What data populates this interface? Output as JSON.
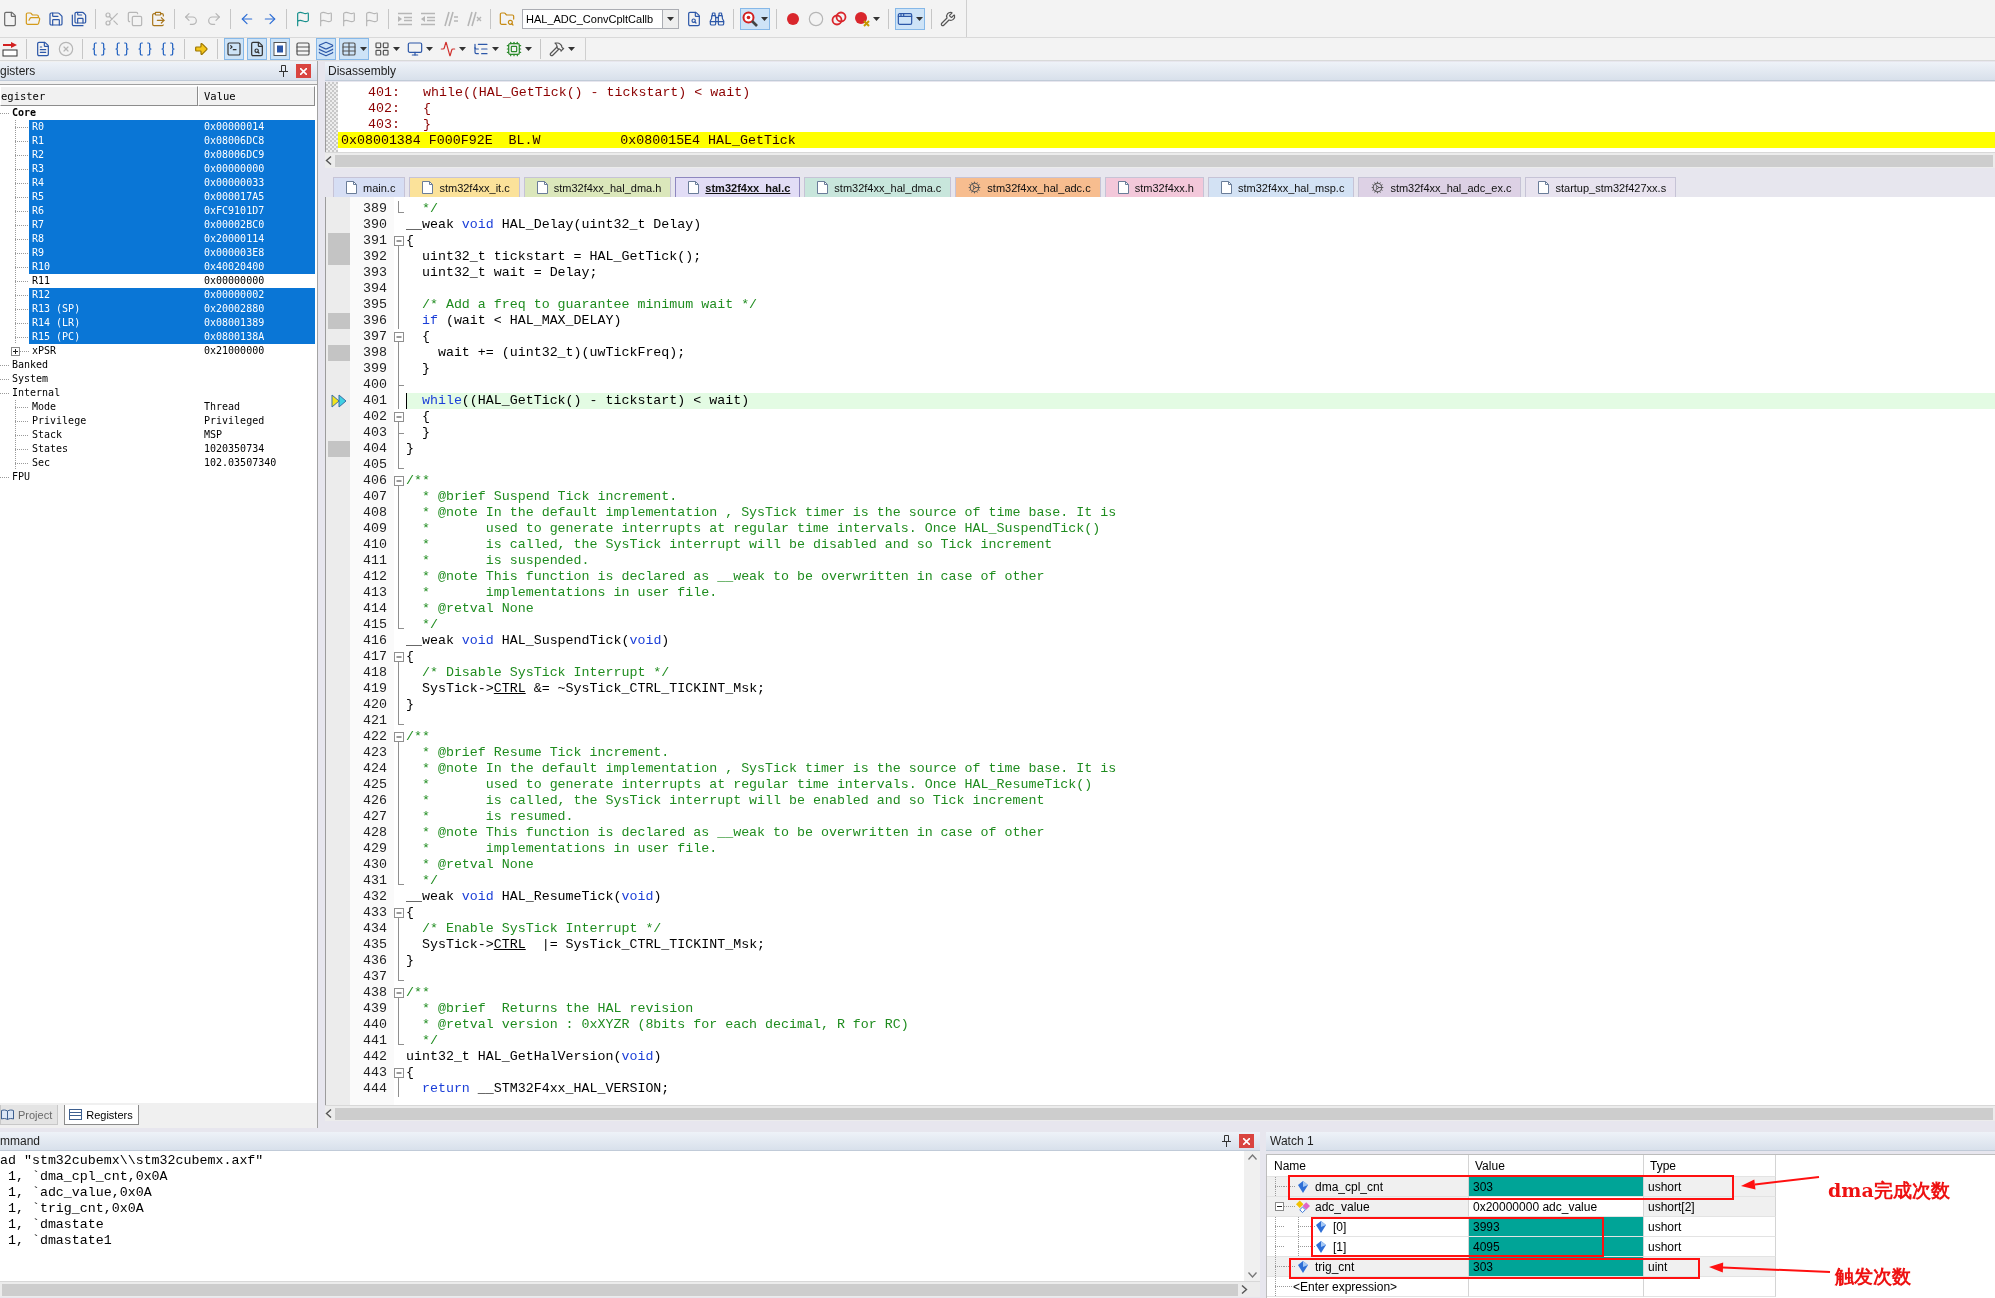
{
  "toolbars": [
    [
      {
        "kind": "new",
        "disabled": false,
        "pressed": false,
        "dropdown": false
      },
      {
        "kind": "open",
        "disabled": false,
        "pressed": false,
        "dropdown": false
      },
      {
        "kind": "save",
        "disabled": false,
        "pressed": false,
        "dropdown": false
      },
      {
        "kind": "saveall",
        "disabled": false,
        "pressed": false,
        "dropdown": false
      },
      {
        "kind": "separator"
      },
      {
        "kind": "cut",
        "disabled": true,
        "pressed": false,
        "dropdown": false
      },
      {
        "kind": "copy",
        "disabled": true,
        "pressed": false,
        "dropdown": false
      },
      {
        "kind": "paste",
        "disabled": false,
        "pressed": false,
        "dropdown": false
      },
      {
        "kind": "separator"
      },
      {
        "kind": "undo",
        "disabled": true,
        "pressed": false,
        "dropdown": false
      },
      {
        "kind": "redo",
        "disabled": true,
        "pressed": false,
        "dropdown": false
      },
      {
        "kind": "separator"
      },
      {
        "kind": "back",
        "disabled": false,
        "pressed": false,
        "dropdown": false
      },
      {
        "kind": "forward",
        "disabled": false,
        "pressed": false,
        "dropdown": false
      },
      {
        "kind": "separator"
      },
      {
        "kind": "bookmark",
        "disabled": false,
        "pressed": false,
        "dropdown": false
      },
      {
        "kind": "prevmark",
        "disabled": true,
        "pressed": false,
        "dropdown": false
      },
      {
        "kind": "nextmark",
        "disabled": true,
        "pressed": false,
        "dropdown": false
      },
      {
        "kind": "clearmarks",
        "disabled": true,
        "pressed": false,
        "dropdown": false
      },
      {
        "kind": "separator"
      },
      {
        "kind": "indent",
        "disabled": true,
        "pressed": false,
        "dropdown": false
      },
      {
        "kind": "outdent",
        "disabled": true,
        "pressed": false,
        "dropdown": false
      },
      {
        "kind": "comment",
        "disabled": true,
        "pressed": false,
        "dropdown": false
      },
      {
        "kind": "uncomment",
        "disabled": true,
        "pressed": false,
        "dropdown": false
      },
      {
        "kind": "separator"
      },
      {
        "kind": "findfiles",
        "disabled": false,
        "pressed": false,
        "dropdown": false
      },
      {
        "kind": "combo",
        "value": "HAL_ADC_ConvCpltCallb"
      },
      {
        "kind": "find",
        "disabled": false,
        "pressed": false,
        "dropdown": false
      },
      {
        "kind": "incfind",
        "disabled": false,
        "pressed": false,
        "dropdown": false
      },
      {
        "kind": "separator"
      },
      {
        "kind": "debug",
        "disabled": false,
        "pressed": true,
        "dropdown": true
      },
      {
        "kind": "separator"
      },
      {
        "kind": "breakpoint",
        "disabled": false,
        "pressed": false,
        "dropdown": false
      },
      {
        "kind": "bptoggle",
        "disabled": true,
        "pressed": false,
        "dropdown": false
      },
      {
        "kind": "bpdisableall",
        "disabled": false,
        "pressed": false,
        "dropdown": false
      },
      {
        "kind": "bpkill",
        "disabled": false,
        "pressed": false,
        "dropdown": true
      },
      {
        "kind": "separator"
      },
      {
        "kind": "layout",
        "disabled": false,
        "pressed": true,
        "dropdown": true
      },
      {
        "kind": "separator"
      },
      {
        "kind": "config",
        "disabled": false,
        "pressed": false,
        "dropdown": false
      }
    ],
    [
      {
        "kind": "reset",
        "disabled": false,
        "pressed": false,
        "dropdown": false
      },
      {
        "kind": "separator"
      },
      {
        "kind": "run",
        "disabled": false,
        "pressed": false,
        "dropdown": false
      },
      {
        "kind": "stop",
        "disabled": true,
        "pressed": false,
        "dropdown": false
      },
      {
        "kind": "separator"
      },
      {
        "kind": "stepin",
        "disabled": false,
        "pressed": false,
        "dropdown": false
      },
      {
        "kind": "stepover",
        "disabled": false,
        "pressed": false,
        "dropdown": false
      },
      {
        "kind": "stepout",
        "disabled": false,
        "pressed": false,
        "dropdown": false
      },
      {
        "kind": "runcursor",
        "disabled": false,
        "pressed": false,
        "dropdown": false
      },
      {
        "kind": "separator"
      },
      {
        "kind": "nextstmt",
        "disabled": false,
        "pressed": false,
        "dropdown": false
      },
      {
        "kind": "separator"
      },
      {
        "kind": "cmdwin",
        "disabled": false,
        "pressed": true,
        "dropdown": false
      },
      {
        "kind": "disasm",
        "disabled": false,
        "pressed": true,
        "dropdown": false
      },
      {
        "kind": "symbols",
        "disabled": false,
        "pressed": true,
        "dropdown": false
      },
      {
        "kind": "regs",
        "disabled": false,
        "pressed": false,
        "dropdown": false
      },
      {
        "kind": "callstack",
        "disabled": false,
        "pressed": true,
        "dropdown": false
      },
      {
        "kind": "watch",
        "disabled": false,
        "pressed": true,
        "dropdown": true
      },
      {
        "kind": "memory",
        "disabled": false,
        "pressed": false,
        "dropdown": true
      },
      {
        "kind": "serial",
        "disabled": false,
        "pressed": false,
        "dropdown": true
      },
      {
        "kind": "analysis",
        "disabled": false,
        "pressed": false,
        "dropdown": true
      },
      {
        "kind": "trace",
        "disabled": false,
        "pressed": false,
        "dropdown": true
      },
      {
        "kind": "sysview",
        "disabled": false,
        "pressed": false,
        "dropdown": true
      },
      {
        "kind": "separator"
      },
      {
        "kind": "toolbox",
        "disabled": false,
        "pressed": false,
        "dropdown": true
      }
    ]
  ],
  "registers": {
    "title": "gisters",
    "columns": [
      "egister",
      "Value"
    ],
    "items": [
      {
        "name": "Core",
        "changed": true,
        "children": [
          {
            "name": "R0",
            "value": "0x00000014",
            "changed": true
          },
          {
            "name": "R1",
            "value": "0x08006DC8",
            "changed": true
          },
          {
            "name": "R2",
            "value": "0x08006DC9",
            "changed": true
          },
          {
            "name": "R3",
            "value": "0x00000000",
            "changed": true
          },
          {
            "name": "R4",
            "value": "0x00000033",
            "changed": true
          },
          {
            "name": "R5",
            "value": "0x000017A5",
            "changed": true
          },
          {
            "name": "R6",
            "value": "0xFC9101D7",
            "changed": true
          },
          {
            "name": "R7",
            "value": "0x00002BC0",
            "changed": true
          },
          {
            "name": "R8",
            "value": "0x20000114",
            "changed": true
          },
          {
            "name": "R9",
            "value": "0x000003E8",
            "changed": true
          },
          {
            "name": "R10",
            "value": "0x40020400",
            "changed": true
          },
          {
            "name": "R11",
            "value": "0x00000000",
            "changed": false
          },
          {
            "name": "R12",
            "value": "0x00000002",
            "changed": true
          },
          {
            "name": "R13 (SP)",
            "value": "0x20002880",
            "changed": true
          },
          {
            "name": "R14 (LR)",
            "value": "0x08001389",
            "changed": true
          },
          {
            "name": "R15 (PC)",
            "value": "0x0800138A",
            "changed": true
          },
          {
            "name": "xPSR",
            "value": "0x21000000",
            "changed": false,
            "expanded": false
          }
        ]
      },
      {
        "name": "Banked",
        "changed": false
      },
      {
        "name": "System",
        "changed": false
      },
      {
        "name": "Internal",
        "changed": false,
        "children": [
          {
            "name": "Mode",
            "value": "Thread",
            "changed": false
          },
          {
            "name": "Privilege",
            "value": "Privileged",
            "changed": false
          },
          {
            "name": "Stack",
            "value": "MSP",
            "changed": false
          },
          {
            "name": "States",
            "value": "1020350734",
            "changed": false
          },
          {
            "name": "Sec",
            "value": "102.03507340",
            "changed": false
          }
        ]
      },
      {
        "name": "FPU",
        "changed": false
      }
    ],
    "tabs": [
      {
        "label": "Project",
        "selected": false
      },
      {
        "label": "Registers",
        "selected": true
      }
    ]
  },
  "disassembly": {
    "title": "Disassembly",
    "lines": [
      {
        "kind": "source",
        "number": "401:",
        "code": "while((HAL_GetTick() - tickstart) < wait)",
        "current": false
      },
      {
        "kind": "source",
        "number": "402:",
        "code": "{",
        "current": false
      },
      {
        "kind": "source",
        "number": "403:",
        "code": "}",
        "current": false
      },
      {
        "kind": "instruction",
        "text": "0x08001384 F000F92E  BL.W          0x080015E4 HAL_GetTick",
        "current": true
      }
    ]
  },
  "editor": {
    "tabs": [
      {
        "label": "main.c",
        "kind": "file",
        "color": "#d6def4",
        "selected": false
      },
      {
        "label": "stm32f4xx_it.c",
        "kind": "file",
        "color": "#fbe29a",
        "selected": false
      },
      {
        "label": "stm32f4xx_hal_dma.h",
        "kind": "file",
        "color": "#dbe7bb",
        "selected": false
      },
      {
        "label": "stm32f4xx_hal.c",
        "kind": "file",
        "color": "#e2ddf6",
        "selected": true
      },
      {
        "label": "stm32f4xx_hal_dma.c",
        "kind": "file",
        "color": "#c8e6dc",
        "selected": false
      },
      {
        "label": "stm32f4xx_hal_adc.c",
        "kind": "gear",
        "color": "#f7bd8f",
        "selected": false
      },
      {
        "label": "stm32f4xx.h",
        "kind": "file",
        "color": "#f3c8da",
        "selected": false
      },
      {
        "label": "stm32f4xx_hal_msp.c",
        "kind": "file",
        "color": "#d3e2f4",
        "selected": false
      },
      {
        "label": "stm32f4xx_hal_adc_ex.c",
        "kind": "gear",
        "color": "#ddd1e5",
        "selected": false
      },
      {
        "label": "startup_stm32f427xx.s",
        "kind": "file",
        "color": "#e8e3ef",
        "selected": false
      }
    ],
    "lines": [
      {
        "number": "389",
        "kind": "foldend",
        "executable": false,
        "current": false,
        "parts": [
          {
            "kind": "comment",
            "text": "  */"
          }
        ]
      },
      {
        "number": "390",
        "kind": "plain",
        "executable": false,
        "current": false,
        "parts": [
          {
            "kind": "code",
            "text": "__weak "
          },
          {
            "kind": "keyword",
            "text": "void"
          },
          {
            "kind": "code",
            "text": " HAL_Delay(uint32_t Delay)"
          }
        ]
      },
      {
        "number": "391",
        "kind": "foldstart",
        "executable": true,
        "current": false,
        "parts": [
          {
            "kind": "code",
            "text": "{"
          }
        ]
      },
      {
        "number": "392",
        "kind": "foldmid",
        "executable": true,
        "current": false,
        "parts": [
          {
            "kind": "code",
            "text": "  uint32_t tickstart = HAL_GetTick();"
          }
        ]
      },
      {
        "number": "393",
        "kind": "foldmid",
        "executable": false,
        "current": false,
        "parts": [
          {
            "kind": "code",
            "text": "  uint32_t wait = Delay;"
          }
        ]
      },
      {
        "number": "394",
        "kind": "foldmid",
        "executable": false,
        "current": false
      },
      {
        "number": "395",
        "kind": "foldmid",
        "executable": false,
        "current": false,
        "parts": [
          {
            "kind": "comment",
            "text": "  /* Add a freq to guarantee minimum wait */"
          }
        ]
      },
      {
        "number": "396",
        "kind": "foldmid",
        "executable": true,
        "current": false,
        "parts": [
          {
            "kind": "keyword",
            "text": "  if"
          },
          {
            "kind": "code",
            "text": " (wait < HAL_MAX_DELAY)"
          }
        ]
      },
      {
        "number": "397",
        "kind": "foldstart",
        "executable": false,
        "current": false,
        "parts": [
          {
            "kind": "code",
            "text": "  {"
          }
        ]
      },
      {
        "number": "398",
        "kind": "foldmid",
        "executable": true,
        "current": false,
        "parts": [
          {
            "kind": "code",
            "text": "    wait += (uint32_t)(uwTickFreq);"
          }
        ]
      },
      {
        "number": "399",
        "kind": "foldmid",
        "executable": false,
        "current": false,
        "parts": [
          {
            "kind": "code",
            "text": "  }"
          }
        ]
      },
      {
        "number": "400",
        "kind": "foldtee",
        "executable": false,
        "current": false
      },
      {
        "number": "401",
        "kind": "foldmid",
        "executable": false,
        "current": true,
        "parts": [
          {
            "kind": "keyword",
            "text": "  while"
          },
          {
            "kind": "code",
            "text": "((HAL_GetTick() - tickstart) < wait)"
          }
        ]
      },
      {
        "number": "402",
        "kind": "foldstart",
        "executable": false,
        "current": false,
        "parts": [
          {
            "kind": "code",
            "text": "  {"
          }
        ]
      },
      {
        "number": "403",
        "kind": "foldtee",
        "executable": false,
        "current": false,
        "parts": [
          {
            "kind": "code",
            "text": "  }"
          }
        ]
      },
      {
        "number": "404",
        "kind": "foldmid",
        "executable": true,
        "current": false,
        "parts": [
          {
            "kind": "code",
            "text": "}"
          }
        ]
      },
      {
        "number": "405",
        "kind": "foldend",
        "executable": false,
        "current": false
      },
      {
        "number": "406",
        "kind": "foldstart",
        "executable": false,
        "current": false,
        "parts": [
          {
            "kind": "comment",
            "text": "/**"
          }
        ]
      },
      {
        "number": "407",
        "kind": "foldmid",
        "executable": false,
        "current": false,
        "parts": [
          {
            "kind": "comment",
            "text": "  * @brief Suspend Tick increment."
          }
        ]
      },
      {
        "number": "408",
        "kind": "foldmid",
        "executable": false,
        "current": false,
        "parts": [
          {
            "kind": "comment",
            "text": "  * @note In the default implementation , SysTick timer is the source of time base. It is"
          }
        ]
      },
      {
        "number": "409",
        "kind": "foldmid",
        "executable": false,
        "current": false,
        "parts": [
          {
            "kind": "comment",
            "text": "  *       used to generate interrupts at regular time intervals. Once HAL_SuspendTick()"
          }
        ]
      },
      {
        "number": "410",
        "kind": "foldmid",
        "executable": false,
        "current": false,
        "parts": [
          {
            "kind": "comment",
            "text": "  *       is called, the SysTick interrupt will be disabled and so Tick increment"
          }
        ]
      },
      {
        "number": "411",
        "kind": "foldmid",
        "executable": false,
        "current": false,
        "parts": [
          {
            "kind": "comment",
            "text": "  *       is suspended."
          }
        ]
      },
      {
        "number": "412",
        "kind": "foldmid",
        "executable": false,
        "current": false,
        "parts": [
          {
            "kind": "comment",
            "text": "  * @note This function is declared as __weak to be overwritten in case of other"
          }
        ]
      },
      {
        "number": "413",
        "kind": "foldmid",
        "executable": false,
        "current": false,
        "parts": [
          {
            "kind": "comment",
            "text": "  *       implementations in user file."
          }
        ]
      },
      {
        "number": "414",
        "kind": "foldmid",
        "executable": false,
        "current": false,
        "parts": [
          {
            "kind": "comment",
            "text": "  * @retval None"
          }
        ]
      },
      {
        "number": "415",
        "kind": "foldend",
        "executable": false,
        "current": false,
        "parts": [
          {
            "kind": "comment",
            "text": "  */"
          }
        ]
      },
      {
        "number": "416",
        "kind": "plain",
        "executable": false,
        "current": false,
        "parts": [
          {
            "kind": "code",
            "text": "__weak "
          },
          {
            "kind": "keyword",
            "text": "void"
          },
          {
            "kind": "code",
            "text": " HAL_SuspendTick("
          },
          {
            "kind": "keyword",
            "text": "void"
          },
          {
            "kind": "code",
            "text": ")"
          }
        ]
      },
      {
        "number": "417",
        "kind": "foldstart",
        "executable": false,
        "current": false,
        "parts": [
          {
            "kind": "code",
            "text": "{"
          }
        ]
      },
      {
        "number": "418",
        "kind": "foldmid",
        "executable": false,
        "current": false,
        "parts": [
          {
            "kind": "comment",
            "text": "  /* Disable SysTick Interrupt */"
          }
        ]
      },
      {
        "number": "419",
        "kind": "foldmid",
        "executable": false,
        "current": false,
        "parts": [
          {
            "kind": "code",
            "text": "  SysTick->"
          },
          {
            "kind": "member",
            "text": "CTRL"
          },
          {
            "kind": "code",
            "text": " &= ~SysTick_CTRL_TICKINT_Msk;"
          }
        ]
      },
      {
        "number": "420",
        "kind": "foldmid",
        "executable": false,
        "current": false,
        "parts": [
          {
            "kind": "code",
            "text": "}"
          }
        ]
      },
      {
        "number": "421",
        "kind": "foldend",
        "executable": false,
        "current": false
      },
      {
        "number": "422",
        "kind": "foldstart",
        "executable": false,
        "current": false,
        "parts": [
          {
            "kind": "comment",
            "text": "/**"
          }
        ]
      },
      {
        "number": "423",
        "kind": "foldmid",
        "executable": false,
        "current": false,
        "parts": [
          {
            "kind": "comment",
            "text": "  * @brief Resume Tick increment."
          }
        ]
      },
      {
        "number": "424",
        "kind": "foldmid",
        "executable": false,
        "current": false,
        "parts": [
          {
            "kind": "comment",
            "text": "  * @note In the default implementation , SysTick timer is the source of time base. It is"
          }
        ]
      },
      {
        "number": "425",
        "kind": "foldmid",
        "executable": false,
        "current": false,
        "parts": [
          {
            "kind": "comment",
            "text": "  *       used to generate interrupts at regular time intervals. Once HAL_ResumeTick()"
          }
        ]
      },
      {
        "number": "426",
        "kind": "foldmid",
        "executable": false,
        "current": false,
        "parts": [
          {
            "kind": "comment",
            "text": "  *       is called, the SysTick interrupt will be enabled and so Tick increment"
          }
        ]
      },
      {
        "number": "427",
        "kind": "foldmid",
        "executable": false,
        "current": false,
        "parts": [
          {
            "kind": "comment",
            "text": "  *       is resumed."
          }
        ]
      },
      {
        "number": "428",
        "kind": "foldmid",
        "executable": false,
        "current": false,
        "parts": [
          {
            "kind": "comment",
            "text": "  * @note This function is declared as __weak to be overwritten in case of other"
          }
        ]
      },
      {
        "number": "429",
        "kind": "foldmid",
        "executable": false,
        "current": false,
        "parts": [
          {
            "kind": "comment",
            "text": "  *       implementations in user file."
          }
        ]
      },
      {
        "number": "430",
        "kind": "foldmid",
        "executable": false,
        "current": false,
        "parts": [
          {
            "kind": "comment",
            "text": "  * @retval None"
          }
        ]
      },
      {
        "number": "431",
        "kind": "foldend",
        "executable": false,
        "current": false,
        "parts": [
          {
            "kind": "comment",
            "text": "  */"
          }
        ]
      },
      {
        "number": "432",
        "kind": "plain",
        "executable": false,
        "current": false,
        "parts": [
          {
            "kind": "code",
            "text": "__weak "
          },
          {
            "kind": "keyword",
            "text": "void"
          },
          {
            "kind": "code",
            "text": " HAL_ResumeTick("
          },
          {
            "kind": "keyword",
            "text": "void"
          },
          {
            "kind": "code",
            "text": ")"
          }
        ]
      },
      {
        "number": "433",
        "kind": "foldstart",
        "executable": false,
        "current": false,
        "parts": [
          {
            "kind": "code",
            "text": "{"
          }
        ]
      },
      {
        "number": "434",
        "kind": "foldmid",
        "executable": false,
        "current": false,
        "parts": [
          {
            "kind": "comment",
            "text": "  /* Enable SysTick Interrupt */"
          }
        ]
      },
      {
        "number": "435",
        "kind": "foldmid",
        "executable": false,
        "current": false,
        "parts": [
          {
            "kind": "code",
            "text": "  SysTick->"
          },
          {
            "kind": "member",
            "text": "CTRL"
          },
          {
            "kind": "code",
            "text": "  |= SysTick_CTRL_TICKINT_Msk;"
          }
        ]
      },
      {
        "number": "436",
        "kind": "foldmid",
        "executable": false,
        "current": false,
        "parts": [
          {
            "kind": "code",
            "text": "}"
          }
        ]
      },
      {
        "number": "437",
        "kind": "foldend",
        "executable": false,
        "current": false
      },
      {
        "number": "438",
        "kind": "foldstart",
        "executable": false,
        "current": false,
        "parts": [
          {
            "kind": "comment",
            "text": "/**"
          }
        ]
      },
      {
        "number": "439",
        "kind": "foldmid",
        "executable": false,
        "current": false,
        "parts": [
          {
            "kind": "comment",
            "text": "  * @brief  Returns the HAL revision"
          }
        ]
      },
      {
        "number": "440",
        "kind": "foldmid",
        "executable": false,
        "current": false,
        "parts": [
          {
            "kind": "comment",
            "text": "  * @retval version : 0xXYZR (8bits for each decimal, R for RC)"
          }
        ]
      },
      {
        "number": "441",
        "kind": "foldend",
        "executable": false,
        "current": false,
        "parts": [
          {
            "kind": "comment",
            "text": "  */"
          }
        ]
      },
      {
        "number": "442",
        "kind": "plain",
        "executable": false,
        "current": false,
        "parts": [
          {
            "kind": "code",
            "text": "uint32_t HAL_GetHalVersion("
          },
          {
            "kind": "keyword",
            "text": "void"
          },
          {
            "kind": "code",
            "text": ")"
          }
        ]
      },
      {
        "number": "443",
        "kind": "foldstart",
        "executable": false,
        "current": false,
        "parts": [
          {
            "kind": "code",
            "text": "{"
          }
        ]
      },
      {
        "number": "444",
        "kind": "foldmid",
        "executable": false,
        "current": false,
        "parts": [
          {
            "kind": "keyword",
            "text": "  return"
          },
          {
            "kind": "code",
            "text": " __STM32F4xx_HAL_VERSION;"
          }
        ]
      }
    ]
  },
  "command": {
    "title": "mmand",
    "lines": [
      "ad \"stm32cubemx\\\\stm32cubemx.axf\"",
      " 1, `dma_cpl_cnt,0x0A",
      " 1, `adc_value,0x0A",
      " 1, `trig_cnt,0x0A",
      " 1, `dmastate",
      " 1, `dmastate1"
    ]
  },
  "watch": {
    "title": "Watch 1",
    "columns": [
      "Name",
      "Value",
      "Type"
    ],
    "rows": [
      {
        "kind": "variable",
        "name": "dma_cpl_cnt",
        "value": "303",
        "type": "ushort",
        "changed": true
      },
      {
        "kind": "array",
        "name": "adc_value",
        "value": "0x20000000 adc_value",
        "type": "ushort[2]",
        "changed": false,
        "expanded": true,
        "children": [
          {
            "kind": "variable",
            "name": "[0]",
            "value": "3993",
            "type": "ushort",
            "changed": true
          },
          {
            "kind": "variable",
            "name": "[1]",
            "value": "4095",
            "type": "ushort",
            "changed": true
          }
        ]
      },
      {
        "kind": "variable",
        "name": "trig_cnt",
        "value": "303",
        "type": "uint",
        "changed": true
      }
    ],
    "entry_prompt": "<Enter expression>",
    "annotations": [
      {
        "kind": "callout",
        "label": "dma完成次数"
      },
      {
        "kind": "box"
      },
      {
        "kind": "callout",
        "label": "触发次数"
      }
    ]
  }
}
